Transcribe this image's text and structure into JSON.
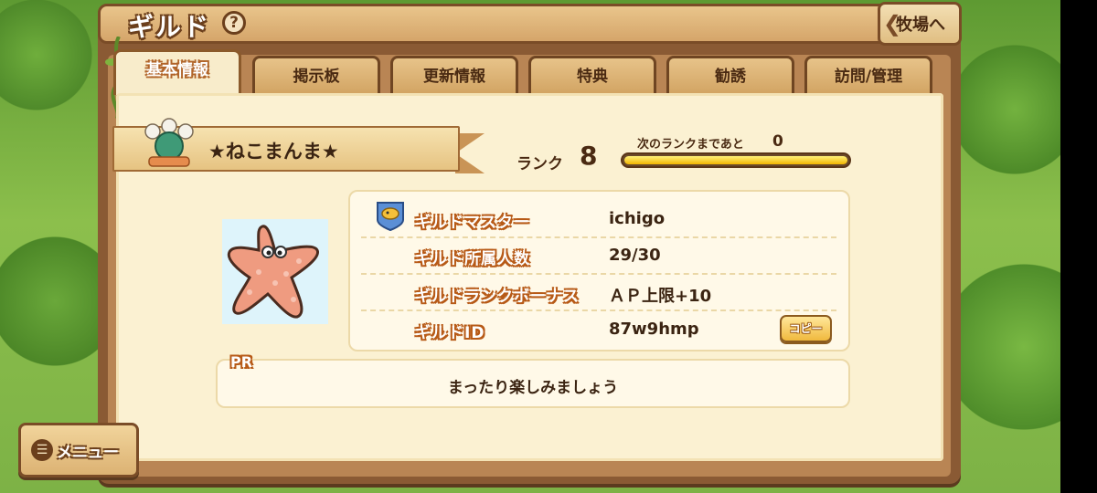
{
  "header": {
    "title": "ギルド",
    "help_icon_label": "?",
    "back_label": "牧場へ"
  },
  "tabs": [
    {
      "label": "基本情報",
      "active": true
    },
    {
      "label": "掲示板"
    },
    {
      "label": "更新情報"
    },
    {
      "label": "特典"
    },
    {
      "label": "勧誘"
    },
    {
      "label": "訪問/管理"
    }
  ],
  "guild": {
    "name": "★ねこまんま★",
    "rank_label": "ランク",
    "rank": "8",
    "next_rank_label": "次のランクまであと",
    "next_rank_remaining": "0",
    "progress": 1.0
  },
  "info": {
    "rows": [
      {
        "key": "ギルドマスター",
        "value": "ichigo"
      },
      {
        "key": "ギルド所属人数",
        "value": "29/30"
      },
      {
        "key": "ギルドランクボーナス",
        "value": "ＡＰ上限+10"
      },
      {
        "key": "ギルドID",
        "value": "87w9hmp"
      }
    ],
    "copy_label": "コピー"
  },
  "pr": {
    "label": "PR",
    "text": "まったり楽しみましょう"
  },
  "menu": {
    "label": "メニュー"
  },
  "icons": {
    "avatar": "starfish-icon",
    "emblem": "guild-emblem-icon",
    "master": "guild-master-badge-icon",
    "menu": "menu-icon"
  }
}
